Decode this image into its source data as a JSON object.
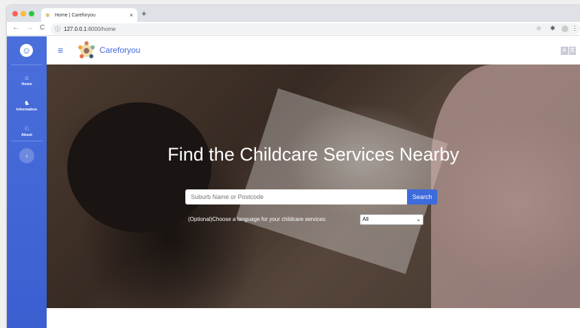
{
  "browser": {
    "tab_title": "Home | Careforyou",
    "tab_close": "×",
    "new_tab": "+",
    "url_host": "127.0.0.1",
    "url_path": ":8000/home",
    "back": "←",
    "forward": "→",
    "reload": "C",
    "info": "ⓘ",
    "star": "☆",
    "extensions": "✱",
    "more": "⋮",
    "traffic_colors": [
      "#ff5f57",
      "#febc2e",
      "#28c840"
    ]
  },
  "sidebar": {
    "items": [
      {
        "label": "Home",
        "icon": "home-icon",
        "glyph": "⌂"
      },
      {
        "label": "Information",
        "icon": "sitemap-icon",
        "glyph": "♞"
      },
      {
        "label": "About",
        "icon": "horse-icon",
        "glyph": "♘"
      }
    ],
    "collapse": "‹"
  },
  "topbar": {
    "menu": "≡",
    "brand": "Careforyou",
    "translate_a": "A",
    "translate_b": "文"
  },
  "hero": {
    "title": "Find the Childcare Services Nearby",
    "search_placeholder": "Suburb Name or Postcode",
    "search_button": "Search",
    "language_label": "(Optional)Choose a language for your childcare services:",
    "language_selected": "All"
  },
  "colors": {
    "accent": "#4466d8",
    "sidebar": "#4a6fdc",
    "search_button": "#3e6bdc"
  }
}
